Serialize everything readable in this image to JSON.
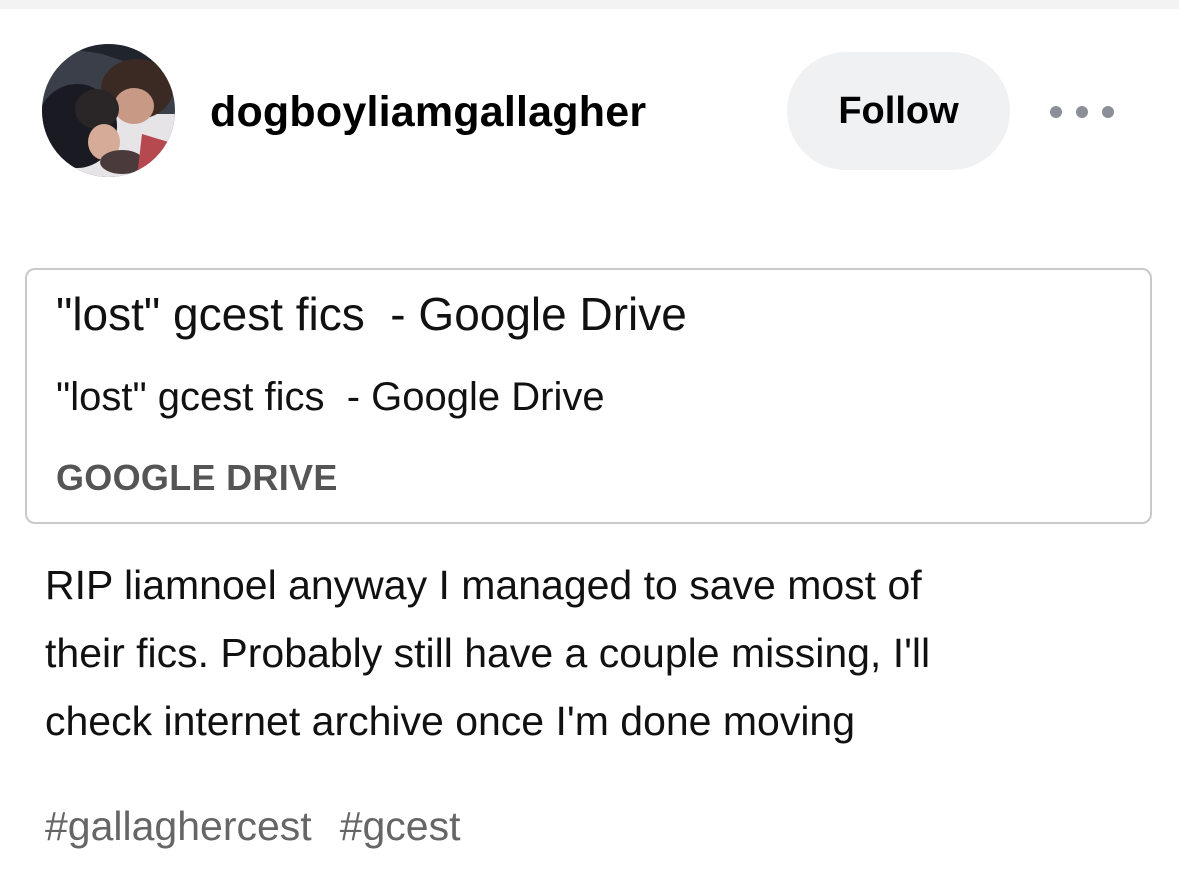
{
  "post": {
    "username": "dogboyliamgallagher",
    "follow_label": "Follow",
    "more_icon": "more-horizontal-icon"
  },
  "link_card": {
    "title": "\"lost\" gcest fics  - Google Drive",
    "subtitle": "\"lost\" gcest fics  - Google Drive",
    "source": "GOOGLE DRIVE"
  },
  "body": {
    "lines": [
      "RIP liamnoel anyway I managed to save most of",
      "their fics. Probably still have a couple missing, I'll",
      "check internet archive once I'm done moving"
    ]
  },
  "tags": [
    "#gallaghercest",
    "#gcest"
  ],
  "colors": {
    "follow_bg": "#f0f1f3",
    "tag_text": "#666666",
    "card_border": "#c9c9c9",
    "source_text": "#555555",
    "more_dots": "#8b8f97"
  }
}
